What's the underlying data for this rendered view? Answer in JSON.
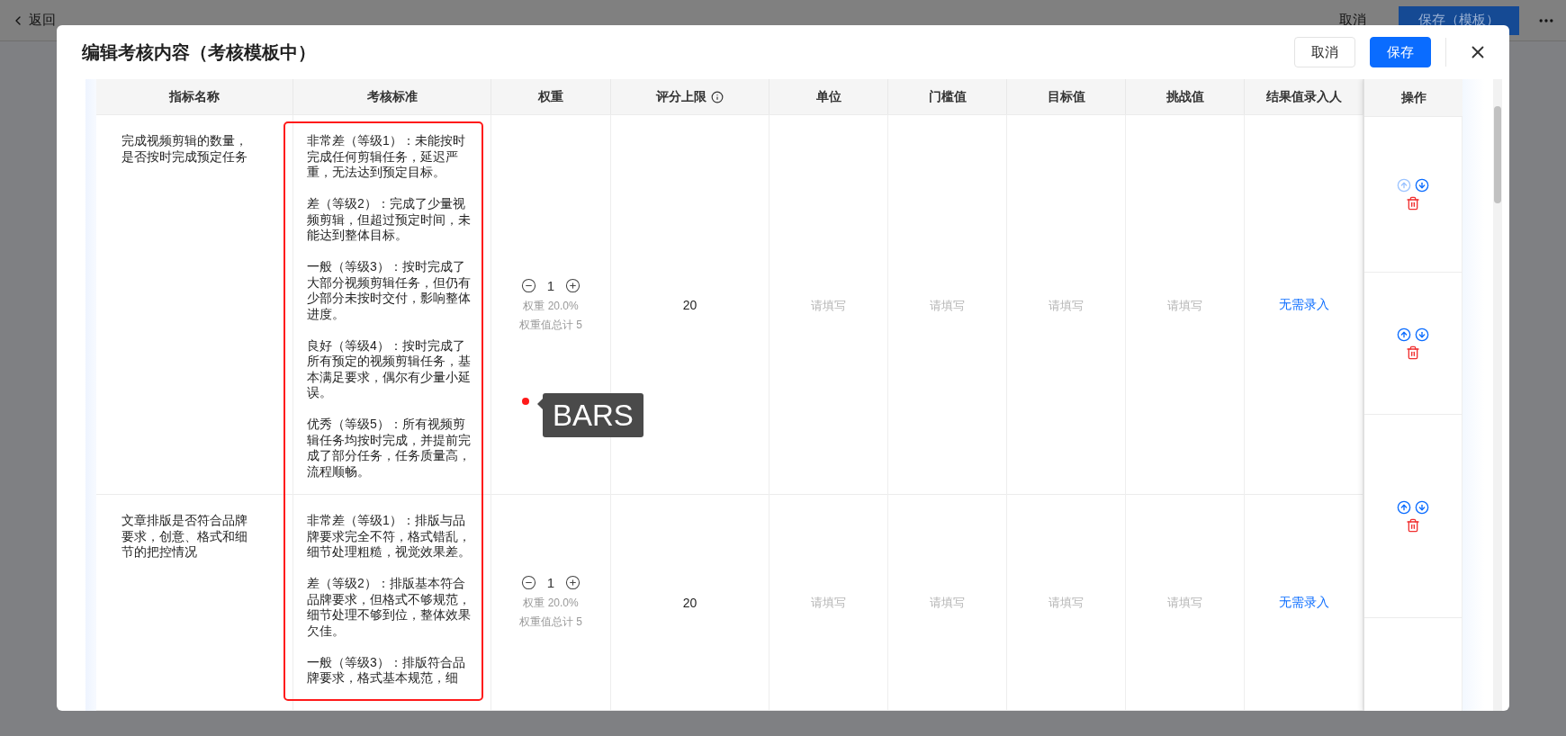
{
  "top_bar": {
    "back": "返回",
    "buttons": [
      {
        "label": "取消",
        "kind": "default"
      },
      {
        "label": "保存（模板）",
        "kind": "primary"
      }
    ]
  },
  "dialog": {
    "title": "编辑考核内容（考核模板中）",
    "buttons": [
      {
        "label": "取消",
        "kind": "default"
      },
      {
        "label": "保存",
        "kind": "primary"
      }
    ]
  },
  "table": {
    "columns": [
      {
        "label": "指标名称"
      },
      {
        "label": "考核标准"
      },
      {
        "label": "权重"
      },
      {
        "label": "评分上限",
        "info": true
      },
      {
        "label": "单位"
      },
      {
        "label": "门槛值"
      },
      {
        "label": "目标值"
      },
      {
        "label": "挑战值"
      },
      {
        "label": "结果值录入人"
      }
    ],
    "action_column": "操作",
    "rows": [
      {
        "name": "完成视频剪辑的数量，是否按时完成预定任务",
        "criteria": [
          "非常差（等级1）：未能按时完成任何剪辑任务，延迟严重，无法达到预定目标。",
          "差（等级2）：完成了少量视频剪辑，但超过预定时间，未能达到整体目标。",
          "一般（等级3）：按时完成了大部分视频剪辑任务，但仍有少部分未按时交付，影响整体进度。",
          "良好（等级4）：按时完成了所有预定的视频剪辑任务，基本满足要求，偶尔有少量小延误。",
          "优秀（等级5）：所有视频剪辑任务均按时完成，并提前完成了部分任务，任务质量高，流程顺畅。"
        ],
        "weight": {
          "value": "1",
          "percent": "权重 20.0%",
          "total": "权重值总计 5"
        },
        "score_max": "20",
        "unit": {
          "placeholder": "请填写"
        },
        "threshold": {
          "placeholder": "请填写"
        },
        "target": {
          "placeholder": "请填写"
        },
        "challenge": {
          "placeholder": "请填写"
        },
        "recorder": "无需录入"
      },
      {
        "name": "文章排版是否符合品牌要求，创意、格式和细节的把控情况",
        "criteria": [
          "非常差（等级1）：排版与品牌要求完全不符，格式错乱，细节处理粗糙，视觉效果差。",
          "差（等级2）：排版基本符合品牌要求，但格式不够规范，细节处理不够到位，整体效果欠佳。",
          "一般（等级3）：排版符合品牌要求，格式基本规范，细"
        ],
        "weight": {
          "value": "1",
          "percent": "权重 20.0%",
          "total": "权重值总计 5"
        },
        "score_max": "20",
        "unit": {
          "placeholder": "请填写"
        },
        "threshold": {
          "placeholder": "请填写"
        },
        "target": {
          "placeholder": "请填写"
        },
        "challenge": {
          "placeholder": "请填写"
        },
        "recorder": "无需录入"
      }
    ],
    "actions": [
      {
        "up_disabled": true
      },
      {
        "up_disabled": false
      },
      {
        "up_disabled": false
      }
    ]
  },
  "annotation": {
    "label": "BARS"
  }
}
